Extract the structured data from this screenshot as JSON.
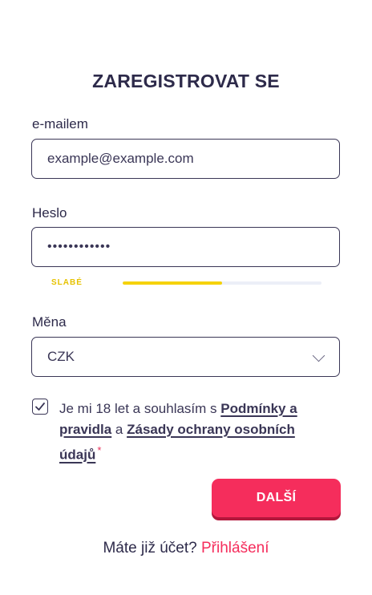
{
  "form": {
    "title": "ZAREGISTROVAT SE",
    "email_label": "e-mailem",
    "email_placeholder": "example@example.com",
    "password_label": "Heslo",
    "password_value": "••••••••••••",
    "strength_label": "SLABÉ",
    "strength_level": 0.5,
    "currency_label": "Měna",
    "currency_value": "CZK",
    "consent_prefix": "Je mi 18 let a souhlasím s ",
    "terms_link": "Podmínky a pravidla",
    "consent_and": " a ",
    "privacy_link": "Zásady ochrany osobních údajů",
    "required_mark": "*",
    "consent_checked": true,
    "next_button": "DALŠÍ"
  },
  "footer": {
    "question": "Máte již účet?",
    "login_link": "Přihlášení"
  },
  "colors": {
    "accent": "#f52d5c",
    "text": "#2d2a4a",
    "strength": "#f5d20a"
  },
  "icons": {
    "dropdown": "chevron-down-icon",
    "checkbox": "checkmark-icon"
  }
}
